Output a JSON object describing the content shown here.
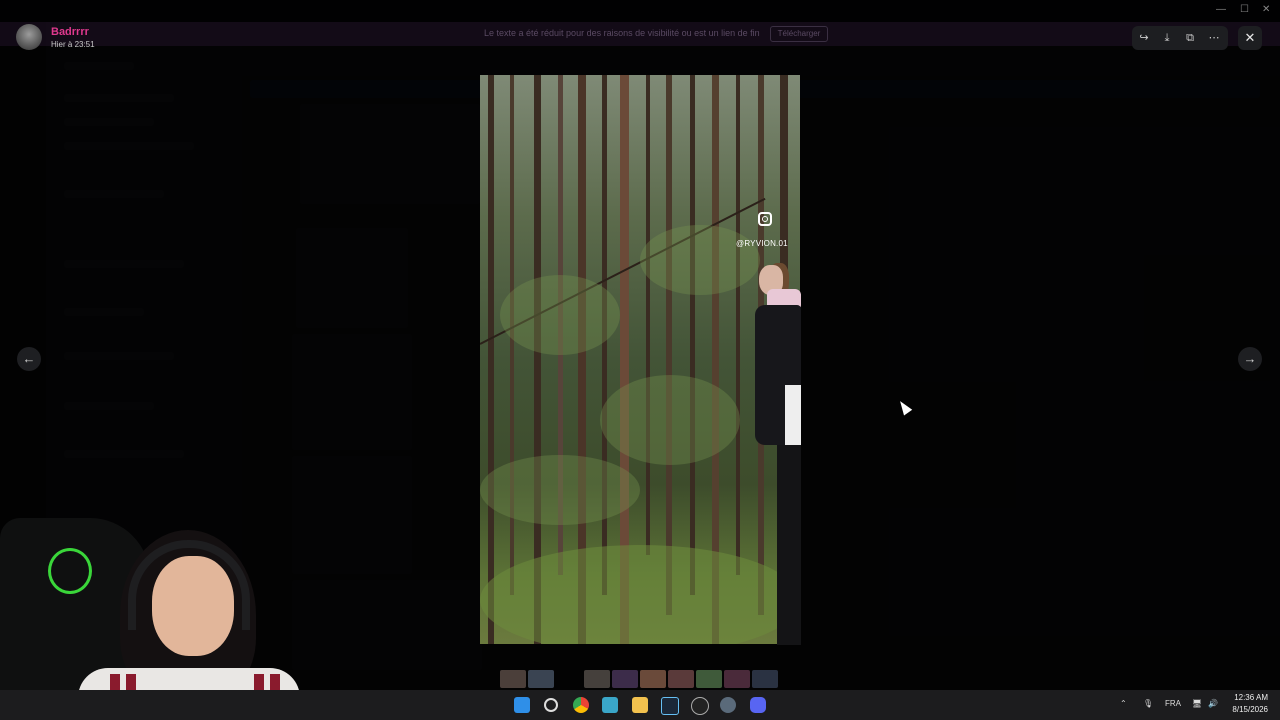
{
  "viewer": {
    "author_name": "Badrrrr",
    "timestamp": "Hier à 23:51",
    "notification_text": "Le texte a été réduit pour des raisons de visibilité ou est un lien de fin",
    "notification_button": "Télécharger"
  },
  "toolbar": {
    "forward_icon": "forward-icon",
    "download_icon": "download-icon",
    "open_icon": "external-link-icon",
    "more_icon": "more-icon",
    "close_icon": "close-icon"
  },
  "media": {
    "watermark_handle": "@RYVION.01"
  },
  "taskbar": {
    "language": "FRA",
    "time": "12:36 AM",
    "date": "8/15/2026"
  },
  "colors": {
    "username": "#e0398e",
    "overlay": "#000000"
  }
}
